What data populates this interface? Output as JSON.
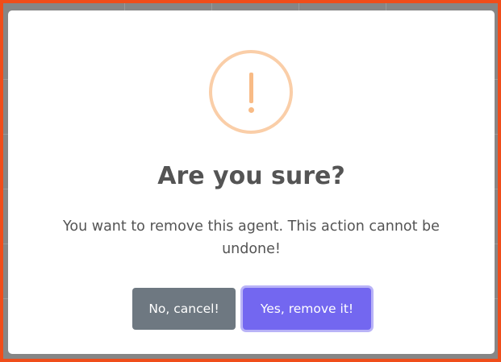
{
  "dialog": {
    "icon": "warning-exclamation-icon",
    "title": "Are you sure?",
    "message": "You want to remove this agent. This action cannot be undone!",
    "cancel_label": "No, cancel!",
    "confirm_label": "Yes, remove it!"
  },
  "colors": {
    "frame_border": "#f04d1a",
    "warning_icon": "#f8bb86",
    "cancel_button": "#6e7881",
    "confirm_button": "#7367f0",
    "title_text": "#545454"
  }
}
